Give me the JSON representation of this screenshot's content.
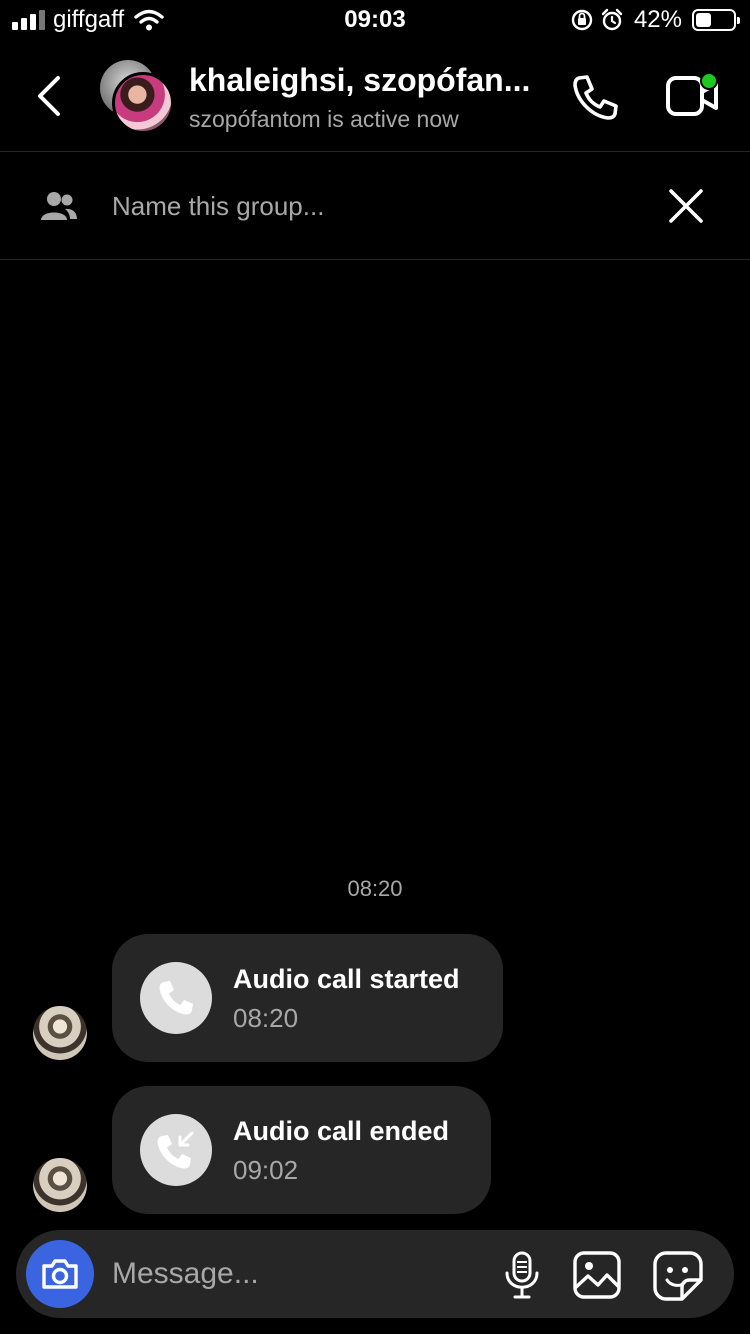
{
  "status_bar": {
    "carrier": "giffgaff",
    "time": "09:03",
    "battery_percent": "42%",
    "battery_level": 0.42,
    "icons": [
      "signal-icon",
      "wifi-icon",
      "orientation-lock-icon",
      "alarm-icon",
      "battery-icon"
    ]
  },
  "header": {
    "title": "khaleighsi, szopófan...",
    "subtitle": "szopófantom is active now",
    "icons": [
      "back-chevron-icon",
      "phone-icon",
      "video-icon"
    ],
    "online_color": "#1ec81e"
  },
  "group_name": {
    "placeholder": "Name this group...",
    "icons": [
      "people-icon",
      "close-icon"
    ]
  },
  "conversation": {
    "timestamp": "08:20",
    "messages": [
      {
        "title": "Audio call started",
        "time": "08:20",
        "icon": "phone-icon"
      },
      {
        "title": "Audio call ended",
        "time": "09:02",
        "icon": "missed-call-icon"
      }
    ]
  },
  "composer": {
    "placeholder": "Message...",
    "camera_color": "#3a64e0",
    "icons": [
      "camera-icon",
      "microphone-icon",
      "gallery-icon",
      "sticker-icon"
    ]
  }
}
